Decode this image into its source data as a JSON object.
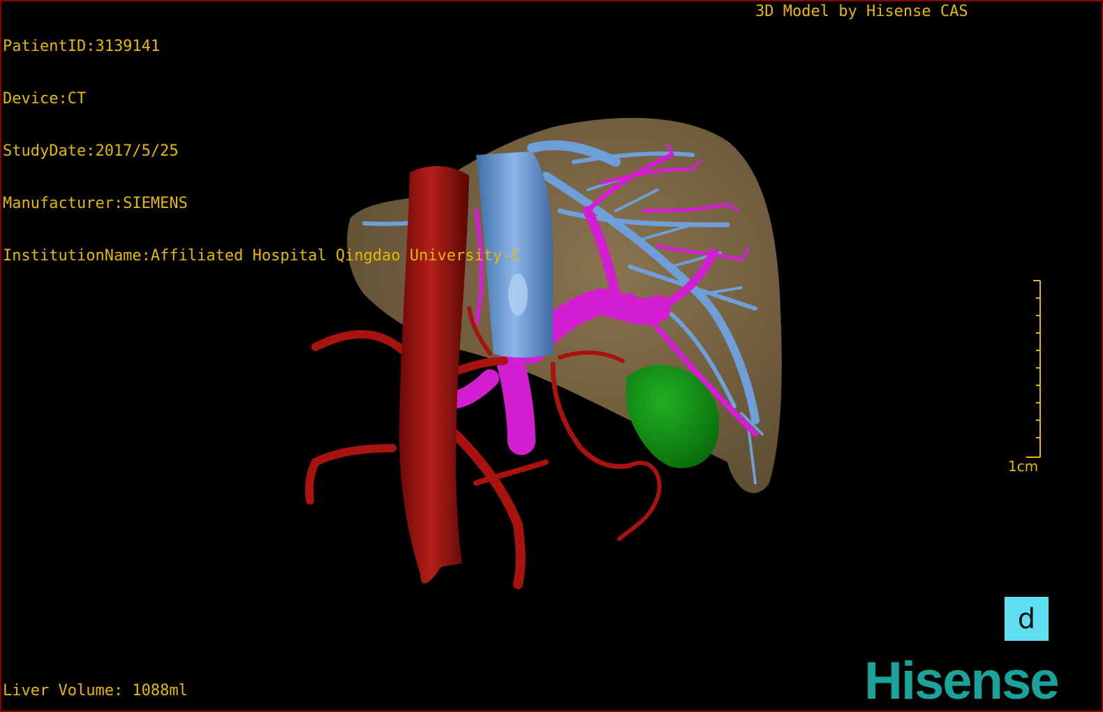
{
  "overlay": {
    "patient_id": "PatientID:3139141",
    "device": "Device:CT",
    "study_date": "StudyDate:2017/5/25",
    "manufacturer": "Manufacturer:SIEMENS",
    "institution": "InstitutionName:Affiliated Hospital Qingdao University-C",
    "credit": "3D Model by Hisense CAS",
    "liver_volume": "Liver Volume: 1088ml"
  },
  "scale": {
    "label": "1cm"
  },
  "view_button": {
    "label": "d"
  },
  "brand": {
    "name": "Hisense"
  },
  "colors": {
    "liver": "#7a6644",
    "aorta": "#a8120f",
    "vena_cava": "#6f9fd8",
    "portal_vein": "#d31fd1",
    "tumor": "#0f8f14",
    "overlay_text": "#e6b800",
    "brand": "#1aa39a",
    "view_button": "#5fe0f2"
  }
}
